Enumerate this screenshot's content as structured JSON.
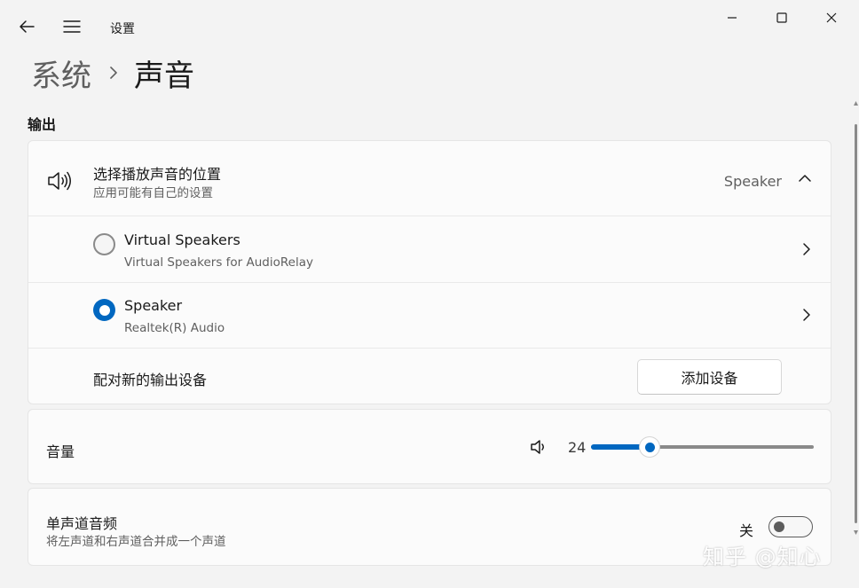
{
  "window": {
    "title": "设置"
  },
  "breadcrumb": {
    "parent": "系统",
    "current": "声音"
  },
  "output": {
    "section_title": "输出",
    "choose": {
      "title": "选择播放声音的位置",
      "subtitle": "应用可能有自己的设置",
      "selected": "Speaker"
    },
    "devices": [
      {
        "name": "Virtual Speakers",
        "description": "Virtual Speakers for AudioRelay",
        "selected": false
      },
      {
        "name": "Speaker",
        "description": "Realtek(R) Audio",
        "selected": true
      }
    ],
    "pair": {
      "label": "配对新的输出设备",
      "button": "添加设备"
    }
  },
  "volume": {
    "label": "音量",
    "value": "24",
    "level": 24
  },
  "mono": {
    "title": "单声道音频",
    "subtitle": "将左声道和右声道合并成一个声道",
    "state_label": "关",
    "on": false
  },
  "watermark": "知乎 @知心",
  "colors": {
    "accent": "#0067c0",
    "background": "#f3f3f3",
    "card": "#fbfbfb"
  }
}
